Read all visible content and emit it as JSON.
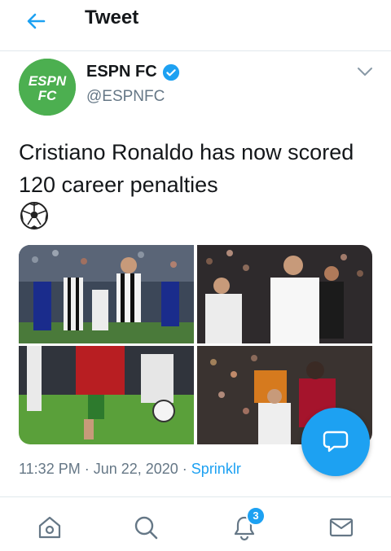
{
  "header": {
    "title": "Tweet",
    "back_icon": "arrow-left-icon"
  },
  "tweet": {
    "author": {
      "display_name": "ESPN FC",
      "handle": "@ESPNFC",
      "verified": true,
      "avatar_text_top": "ESPN",
      "avatar_text_bottom": "FC",
      "avatar_color": "#4caf50"
    },
    "text": "Cristiano Ronaldo has now scored 120 career penalties",
    "emoji_icon": "soccer-ball-icon",
    "media_count": 4,
    "timestamp": "11:32 PM · Jun 22, 2020 · ",
    "source": "Sprinklr"
  },
  "bottom_nav": {
    "items": [
      "home-icon",
      "search-icon",
      "notifications-icon",
      "messages-icon"
    ],
    "notification_count": "3"
  },
  "colors": {
    "accent": "#1da1f2",
    "text": "#14171a",
    "muted": "#657786"
  }
}
